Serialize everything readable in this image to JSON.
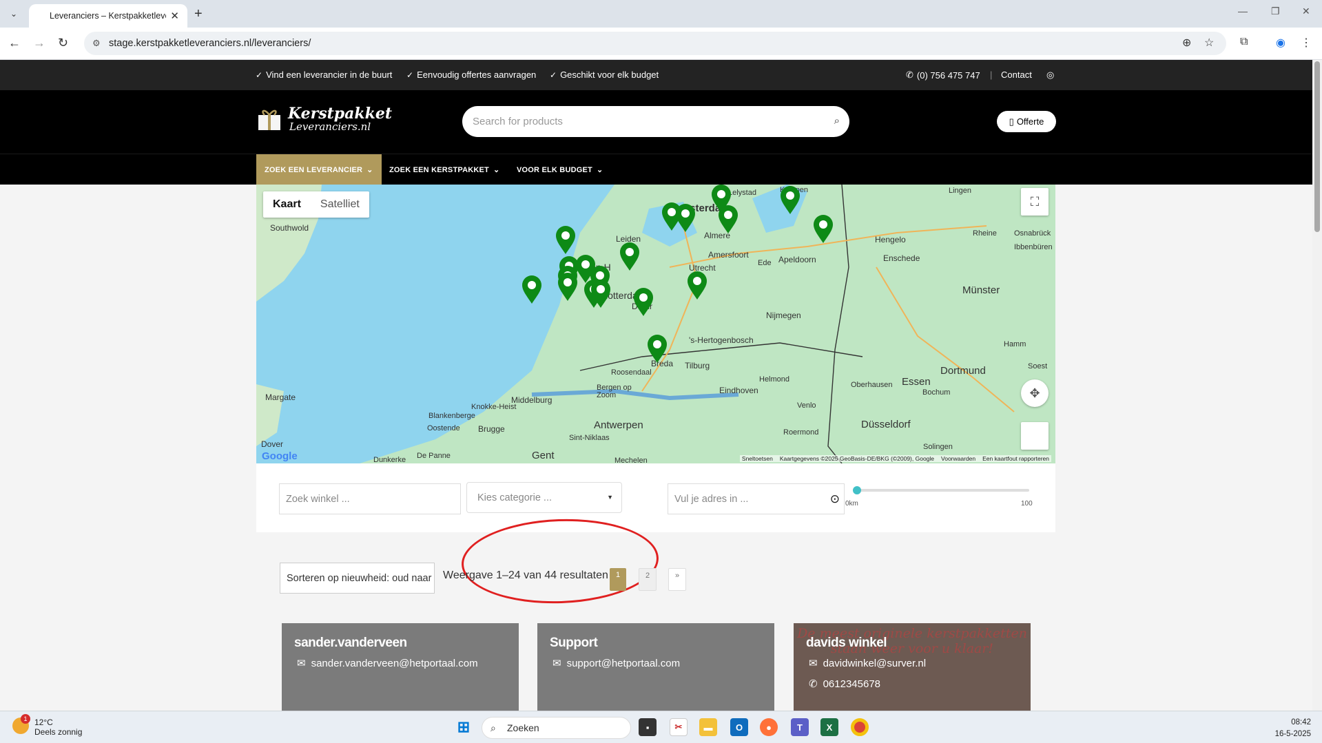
{
  "browser": {
    "tab_title": "Leveranciers – Kerstpakketleveranciers",
    "new_tab": "+",
    "url": "stage.kerstpakketleveranciers.nl/leveranciers/"
  },
  "topbar": {
    "usps": [
      "Vind een leverancier in de buurt",
      "Eenvoudig offertes aanvragen",
      "Geschikt voor elk budget"
    ],
    "phone": "(0) 756 475 747",
    "separator": "|",
    "contact": "Contact"
  },
  "header": {
    "logo_line1": "Kerstpakket",
    "logo_line2": "Leveranciers.nl",
    "search_placeholder": "Search for products",
    "offerte": "Offerte"
  },
  "nav": {
    "items": [
      "ZOEK EEN LEVERANCIER",
      "ZOEK EEN KERSTPAKKET",
      "VOOR ELK BUDGET"
    ]
  },
  "map": {
    "toggle_map": "Kaart",
    "toggle_sat": "Satelliet",
    "google": "Google",
    "footer": [
      "Sneltoetsen",
      "Kaartgegevens ©2025 GeoBasis-DE/BKG (©2009), Google",
      "Voorwaarden",
      "Een kaartfout rapporteren"
    ],
    "labels": [
      "Amsterdam",
      "Leiden",
      "Den H",
      "Rotterda",
      "Dordr",
      "Utrecht",
      "Amersfoort",
      "Almere",
      "Apeldoorn",
      "Nijmegen",
      "Enschede",
      "Hengelo",
      "Münster",
      "Dortmund",
      "Essen",
      "Düsseldorf",
      "Antwerpen",
      "Gent",
      "Breda",
      "Tilburg",
      "'s-Hertogenbosch",
      "Eindhoven",
      "Middelburg",
      "Margate",
      "Dover",
      "Southwold",
      "Helmond",
      "Venlo",
      "Roermond",
      "Bochum",
      "Oberhausen",
      "Solingen",
      "Hamm",
      "Osnabrück",
      "Rheine",
      "Lingen",
      "Knokke-Heist",
      "Brugge",
      "Oostende",
      "Sint-Niklaas",
      "Roosendaal",
      "Bergen op Zoom",
      "Ede",
      "Lelystad",
      "Kampen",
      "Blankenberge",
      "De Panne",
      "Soest",
      "Ibbenbüren",
      "Mechelen",
      "Dunkerke"
    ]
  },
  "filter": {
    "shop_placeholder": "Zoek winkel ...",
    "category_placeholder": "Kies categorie ...",
    "address_placeholder": "Vul je adres in ...",
    "slider_min": "0km",
    "slider_max": "100",
    "slider_value": 0
  },
  "results": {
    "sort_label": "Sorteren op nieuwheid: oud naar nieuw",
    "count_text": "Weergave 1–24 van 44 resultaten",
    "pages": [
      "1",
      "2",
      "»"
    ],
    "cards": [
      {
        "name": "sander.vanderveen",
        "email": "sander.vanderveen@hetportaal.com",
        "phone": ""
      },
      {
        "name": "Support",
        "email": "support@hetportaal.com",
        "phone": ""
      },
      {
        "name": "davids winkel",
        "email": "davidwinkel@surver.nl",
        "phone": "0612345678",
        "banner": "De meest originele kerstpakketten staan weer voor u klaar!"
      }
    ]
  },
  "taskbar": {
    "temp": "12°C",
    "weather": "Deels zonnig",
    "weather_badge": "1",
    "search": "Zoeken",
    "time": "08:42",
    "date": "16-5-2025"
  },
  "colors": {
    "accent": "#b09a5c",
    "marker": "#0e8a16",
    "annotation": "#e02020"
  }
}
